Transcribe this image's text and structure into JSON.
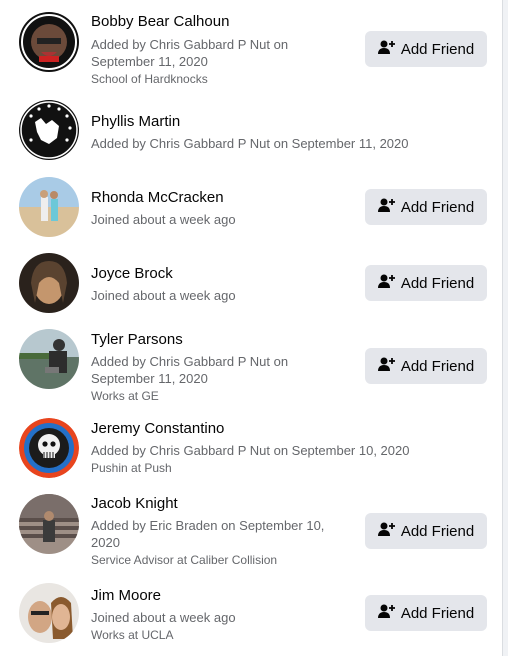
{
  "members": [
    {
      "name": "Bobby Bear Calhoun",
      "sub": "Added by Chris Gabbard P Nut on September 11, 2020",
      "extra": "School of Hardknocks",
      "button": "Add Friend"
    },
    {
      "name": "Phyllis Martin",
      "sub": "Added by Chris Gabbard P Nut on September 11, 2020",
      "extra": ""
    },
    {
      "name": "Rhonda McCracken",
      "sub": "Joined about a week ago",
      "extra": "",
      "button": "Add Friend"
    },
    {
      "name": "Joyce Brock",
      "sub": "Joined about a week ago",
      "extra": "",
      "button": "Add Friend"
    },
    {
      "name": "Tyler Parsons",
      "sub": "Added by Chris Gabbard P Nut on September 11, 2020",
      "extra": "Works at GE",
      "button": "Add Friend"
    },
    {
      "name": "Jeremy Constantino",
      "sub": "Added by Chris Gabbard P Nut on September 10, 2020",
      "extra": "Pushin at Push"
    },
    {
      "name": "Jacob Knight",
      "sub": "Added by Eric Braden on September 10, 2020",
      "extra": "Service Advisor at Caliber Collision",
      "button": "Add Friend"
    },
    {
      "name": "Jim Moore",
      "sub": "Joined about a week ago",
      "extra": "Works at UCLA",
      "button": "Add Friend"
    }
  ],
  "icons": {
    "button_icon": "add-friend-icon"
  }
}
